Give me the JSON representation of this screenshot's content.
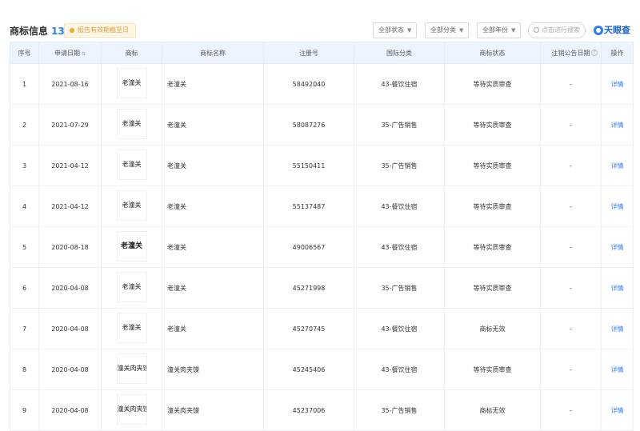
{
  "header": {
    "title": "商标信息",
    "count": "13",
    "tip": "报告有效期截至日",
    "filters": [
      "全部状态",
      "全部分类",
      "全部年份"
    ],
    "search_placeholder": "点击进行搜索",
    "logo": "天眼查"
  },
  "table": {
    "columns": [
      "序号",
      "申请日期",
      "商标",
      "商标名称",
      "注册号",
      "国际分类",
      "商标状态",
      "注销公告日期",
      "操作"
    ],
    "rows": [
      {
        "no": "1",
        "date": "2021-08-16",
        "image_text": "老潼关",
        "name": "老潼关",
        "reg": "58492040",
        "cls": "43-餐饮住宿",
        "status": "等待实质审查",
        "cancel": "-",
        "action": "详情"
      },
      {
        "no": "2",
        "date": "2021-07-29",
        "image_text": "老潼关",
        "name": "老潼关",
        "reg": "58087276",
        "cls": "35-广告销售",
        "status": "等待实质审查",
        "cancel": "-",
        "action": "详情"
      },
      {
        "no": "3",
        "date": "2021-04-12",
        "image_text": "老潼关",
        "name": "老潼关",
        "reg": "55150411",
        "cls": "35-广告销售",
        "status": "等待实质审查",
        "cancel": "-",
        "action": "详情"
      },
      {
        "no": "4",
        "date": "2021-04-12",
        "image_text": "老潼关",
        "name": "老潼关",
        "reg": "55137487",
        "cls": "43-餐饮住宿",
        "status": "等待实质审查",
        "cancel": "-",
        "action": "详情"
      },
      {
        "no": "5",
        "date": "2020-08-18",
        "image_text": "老潼关",
        "name": "老潼关",
        "reg": "49006567",
        "cls": "43-餐饮住宿",
        "status": "等待实质审查",
        "cancel": "-",
        "action": "详情"
      },
      {
        "no": "6",
        "date": "2020-04-08",
        "image_text": "老潼关",
        "name": "老潼关",
        "reg": "45271998",
        "cls": "35-广告销售",
        "status": "等待实质审查",
        "cancel": "-",
        "action": "详情"
      },
      {
        "no": "7",
        "date": "2020-04-08",
        "image_text": "老潼关",
        "name": "老潼关",
        "reg": "45270745",
        "cls": "43-餐饮住宿",
        "status": "商标无效",
        "cancel": "-",
        "action": "详情"
      },
      {
        "no": "8",
        "date": "2020-04-08",
        "image_text": "潼关肉夹馍",
        "name": "潼关肉夹馍",
        "reg": "45245406",
        "cls": "43-餐饮住宿",
        "status": "等待实质审查",
        "cancel": "-",
        "action": "详情"
      },
      {
        "no": "9",
        "date": "2020-04-08",
        "image_text": "潼关肉夹馍",
        "name": "潼关肉夹馍",
        "reg": "45237006",
        "cls": "35-广告销售",
        "status": "商标无效",
        "cancel": "-",
        "action": "详情"
      }
    ]
  }
}
